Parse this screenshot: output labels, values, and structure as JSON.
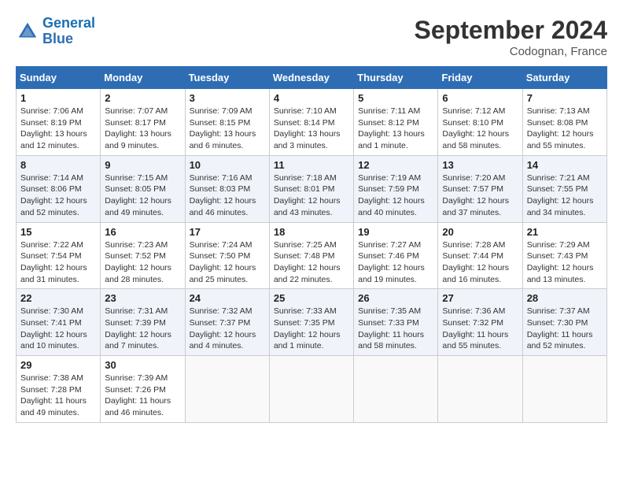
{
  "logo": {
    "line1": "General",
    "line2": "Blue"
  },
  "title": "September 2024",
  "location": "Codognan, France",
  "days_of_week": [
    "Sunday",
    "Monday",
    "Tuesday",
    "Wednesday",
    "Thursday",
    "Friday",
    "Saturday"
  ],
  "weeks": [
    [
      {
        "day": "1",
        "info": "Sunrise: 7:06 AM\nSunset: 8:19 PM\nDaylight: 13 hours\nand 12 minutes."
      },
      {
        "day": "2",
        "info": "Sunrise: 7:07 AM\nSunset: 8:17 PM\nDaylight: 13 hours\nand 9 minutes."
      },
      {
        "day": "3",
        "info": "Sunrise: 7:09 AM\nSunset: 8:15 PM\nDaylight: 13 hours\nand 6 minutes."
      },
      {
        "day": "4",
        "info": "Sunrise: 7:10 AM\nSunset: 8:14 PM\nDaylight: 13 hours\nand 3 minutes."
      },
      {
        "day": "5",
        "info": "Sunrise: 7:11 AM\nSunset: 8:12 PM\nDaylight: 13 hours\nand 1 minute."
      },
      {
        "day": "6",
        "info": "Sunrise: 7:12 AM\nSunset: 8:10 PM\nDaylight: 12 hours\nand 58 minutes."
      },
      {
        "day": "7",
        "info": "Sunrise: 7:13 AM\nSunset: 8:08 PM\nDaylight: 12 hours\nand 55 minutes."
      }
    ],
    [
      {
        "day": "8",
        "info": "Sunrise: 7:14 AM\nSunset: 8:06 PM\nDaylight: 12 hours\nand 52 minutes."
      },
      {
        "day": "9",
        "info": "Sunrise: 7:15 AM\nSunset: 8:05 PM\nDaylight: 12 hours\nand 49 minutes."
      },
      {
        "day": "10",
        "info": "Sunrise: 7:16 AM\nSunset: 8:03 PM\nDaylight: 12 hours\nand 46 minutes."
      },
      {
        "day": "11",
        "info": "Sunrise: 7:18 AM\nSunset: 8:01 PM\nDaylight: 12 hours\nand 43 minutes."
      },
      {
        "day": "12",
        "info": "Sunrise: 7:19 AM\nSunset: 7:59 PM\nDaylight: 12 hours\nand 40 minutes."
      },
      {
        "day": "13",
        "info": "Sunrise: 7:20 AM\nSunset: 7:57 PM\nDaylight: 12 hours\nand 37 minutes."
      },
      {
        "day": "14",
        "info": "Sunrise: 7:21 AM\nSunset: 7:55 PM\nDaylight: 12 hours\nand 34 minutes."
      }
    ],
    [
      {
        "day": "15",
        "info": "Sunrise: 7:22 AM\nSunset: 7:54 PM\nDaylight: 12 hours\nand 31 minutes."
      },
      {
        "day": "16",
        "info": "Sunrise: 7:23 AM\nSunset: 7:52 PM\nDaylight: 12 hours\nand 28 minutes."
      },
      {
        "day": "17",
        "info": "Sunrise: 7:24 AM\nSunset: 7:50 PM\nDaylight: 12 hours\nand 25 minutes."
      },
      {
        "day": "18",
        "info": "Sunrise: 7:25 AM\nSunset: 7:48 PM\nDaylight: 12 hours\nand 22 minutes."
      },
      {
        "day": "19",
        "info": "Sunrise: 7:27 AM\nSunset: 7:46 PM\nDaylight: 12 hours\nand 19 minutes."
      },
      {
        "day": "20",
        "info": "Sunrise: 7:28 AM\nSunset: 7:44 PM\nDaylight: 12 hours\nand 16 minutes."
      },
      {
        "day": "21",
        "info": "Sunrise: 7:29 AM\nSunset: 7:43 PM\nDaylight: 12 hours\nand 13 minutes."
      }
    ],
    [
      {
        "day": "22",
        "info": "Sunrise: 7:30 AM\nSunset: 7:41 PM\nDaylight: 12 hours\nand 10 minutes."
      },
      {
        "day": "23",
        "info": "Sunrise: 7:31 AM\nSunset: 7:39 PM\nDaylight: 12 hours\nand 7 minutes."
      },
      {
        "day": "24",
        "info": "Sunrise: 7:32 AM\nSunset: 7:37 PM\nDaylight: 12 hours\nand 4 minutes."
      },
      {
        "day": "25",
        "info": "Sunrise: 7:33 AM\nSunset: 7:35 PM\nDaylight: 12 hours\nand 1 minute."
      },
      {
        "day": "26",
        "info": "Sunrise: 7:35 AM\nSunset: 7:33 PM\nDaylight: 11 hours\nand 58 minutes."
      },
      {
        "day": "27",
        "info": "Sunrise: 7:36 AM\nSunset: 7:32 PM\nDaylight: 11 hours\nand 55 minutes."
      },
      {
        "day": "28",
        "info": "Sunrise: 7:37 AM\nSunset: 7:30 PM\nDaylight: 11 hours\nand 52 minutes."
      }
    ],
    [
      {
        "day": "29",
        "info": "Sunrise: 7:38 AM\nSunset: 7:28 PM\nDaylight: 11 hours\nand 49 minutes."
      },
      {
        "day": "30",
        "info": "Sunrise: 7:39 AM\nSunset: 7:26 PM\nDaylight: 11 hours\nand 46 minutes."
      },
      {
        "day": "",
        "info": ""
      },
      {
        "day": "",
        "info": ""
      },
      {
        "day": "",
        "info": ""
      },
      {
        "day": "",
        "info": ""
      },
      {
        "day": "",
        "info": ""
      }
    ]
  ]
}
